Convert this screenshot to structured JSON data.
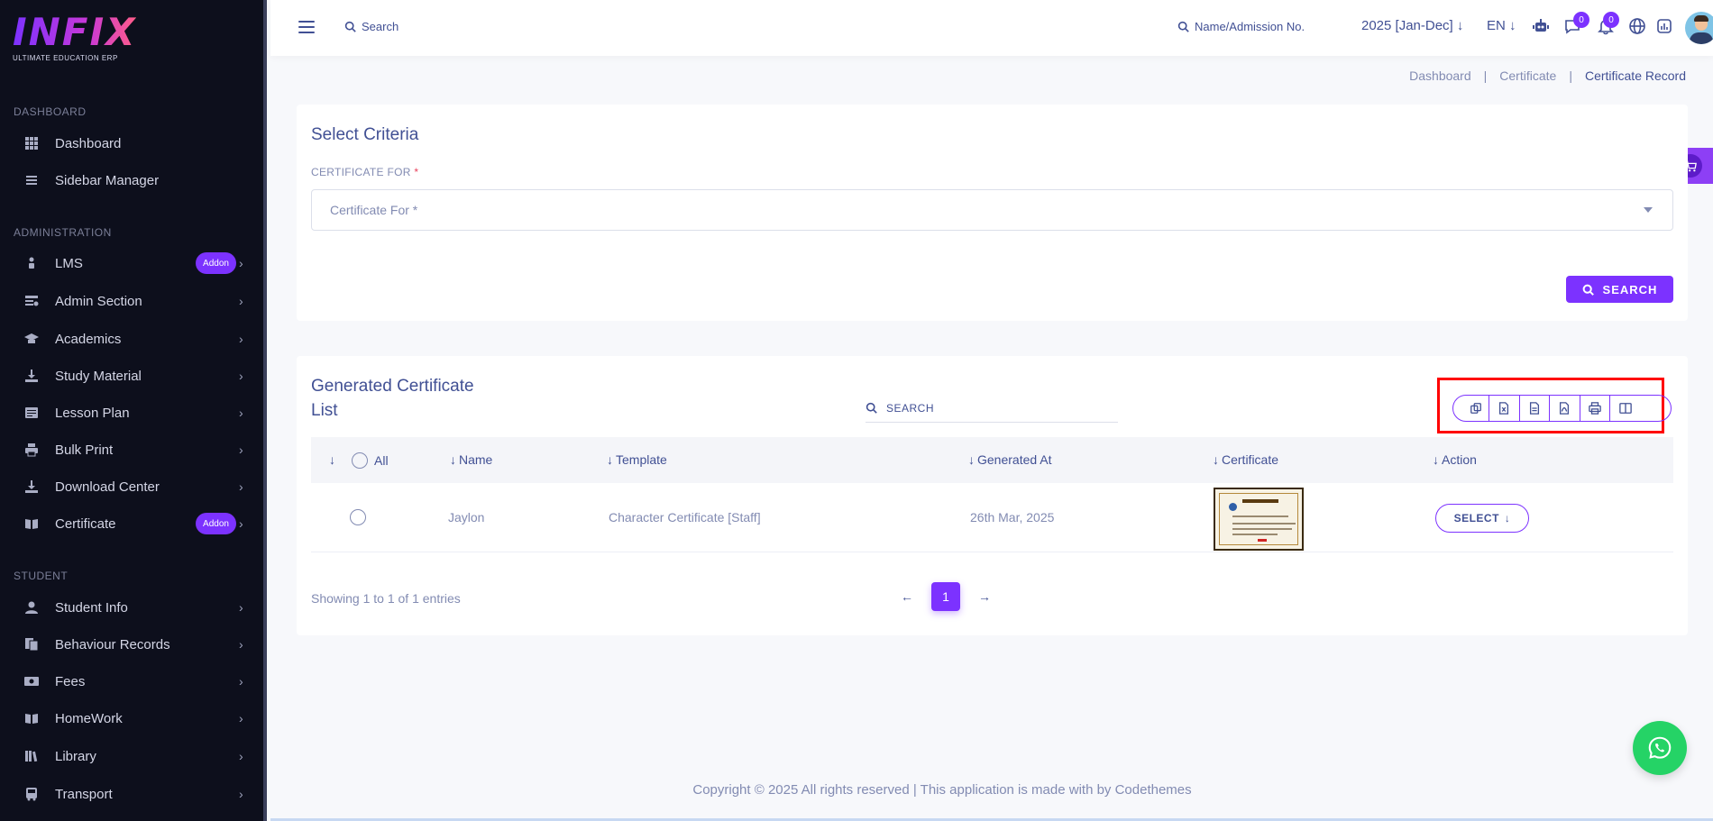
{
  "brand": {
    "logo": "INFIX",
    "tagline": "ULTIMATE EDUCATION ERP"
  },
  "sidebar": {
    "sections": [
      "DASHBOARD",
      "ADMINISTRATION",
      "STUDENT"
    ],
    "items": [
      {
        "label": "Dashboard",
        "icon": "grid-icon"
      },
      {
        "label": "Sidebar Manager",
        "icon": "menu-icon"
      },
      {
        "label": "LMS",
        "icon": "lms-icon",
        "badge": "Addon"
      },
      {
        "label": "Admin Section",
        "icon": "admin-icon"
      },
      {
        "label": "Academics",
        "icon": "graduation-cap-icon"
      },
      {
        "label": "Study Material",
        "icon": "download-icon"
      },
      {
        "label": "Lesson Plan",
        "icon": "lesson-icon"
      },
      {
        "label": "Bulk Print",
        "icon": "printer-icon"
      },
      {
        "label": "Download Center",
        "icon": "download-icon"
      },
      {
        "label": "Certificate",
        "icon": "book-icon",
        "badge": "Addon"
      },
      {
        "label": "Student Info",
        "icon": "user-icon"
      },
      {
        "label": "Behaviour Records",
        "icon": "records-icon"
      },
      {
        "label": "Fees",
        "icon": "money-icon"
      },
      {
        "label": "HomeWork",
        "icon": "book-icon"
      },
      {
        "label": "Library",
        "icon": "library-icon"
      },
      {
        "label": "Transport",
        "icon": "bus-icon"
      }
    ]
  },
  "topbar": {
    "search_label": "Search",
    "name_search_label": "Name/Admission No.",
    "year": "2025 [Jan-Dec]",
    "lang": "EN",
    "chat_badge": "0",
    "notif_badge": "0"
  },
  "breadcrumb": [
    "Dashboard",
    "Certificate",
    "Certificate Record"
  ],
  "criteria": {
    "title": "Select Criteria",
    "field_label": "CERTIFICATE FOR",
    "required_mark": "*",
    "select_placeholder": "Certificate For *",
    "search_button": "SEARCH"
  },
  "list": {
    "title_line1": "Generated Certificate",
    "title_line2": "List",
    "search_placeholder": "SEARCH",
    "columns": {
      "all": "All",
      "name": "Name",
      "template": "Template",
      "generated_at": "Generated At",
      "certificate": "Certificate",
      "action": "Action"
    },
    "rows": [
      {
        "name": "Jaylon",
        "template": "Character Certificate [Staff]",
        "generated_at": "26th Mar, 2025",
        "action": "SELECT"
      }
    ],
    "showing": "Showing 1 to 1 of 1 entries",
    "current_page": "1"
  },
  "footer": "Copyright © 2025 All rights reserved | This application is made with by Codethemes",
  "colors": {
    "accent": "#7c32ff",
    "text": "#415094",
    "muted": "#828bb2",
    "sidebar_bg": "#0d0f1c",
    "highlight": "#ff0000",
    "whatsapp": "#25d366"
  }
}
